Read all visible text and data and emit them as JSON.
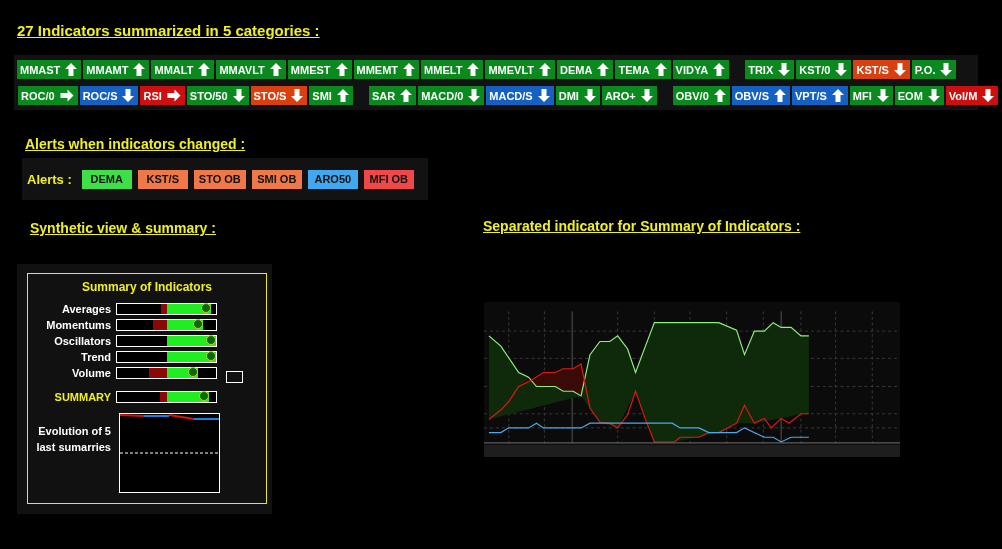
{
  "title": "27 Indicators summarized in 5 categories :",
  "indicator_rows": [
    {
      "groups": [
        [
          {
            "label": "MMAST",
            "kind": "up",
            "color": "#0a8a1e"
          },
          {
            "label": "MMAMT",
            "kind": "up",
            "color": "#0a8a1e"
          },
          {
            "label": "MMALT",
            "kind": "up",
            "color": "#0a8a1e"
          },
          {
            "label": "MMAVLT",
            "kind": "up",
            "color": "#0a8a1e"
          },
          {
            "label": "MMEST",
            "kind": "up",
            "color": "#0a8a1e"
          },
          {
            "label": "MMEMT",
            "kind": "up",
            "color": "#0a8a1e"
          },
          {
            "label": "MMELT",
            "kind": "up",
            "color": "#0a8a1e"
          },
          {
            "label": "MMEVLT",
            "kind": "up",
            "color": "#0a8a1e"
          },
          {
            "label": "DEMA",
            "kind": "up",
            "color": "#0a8a1e"
          },
          {
            "label": "TEMA",
            "kind": "up",
            "color": "#0a8a1e"
          },
          {
            "label": "VIDYA",
            "kind": "up",
            "color": "#0a8a1e"
          }
        ],
        [
          {
            "label": "TRIX",
            "kind": "down",
            "color": "#0a8a1e"
          },
          {
            "label": "KST/0",
            "kind": "down",
            "color": "#0a8a1e"
          },
          {
            "label": "KST/S",
            "kind": "down",
            "color": "#d84010"
          },
          {
            "label": "P.O.",
            "kind": "down",
            "color": "#0a8a1e"
          }
        ]
      ]
    },
    {
      "groups": [
        [
          {
            "label": "ROC/0",
            "kind": "right",
            "color": "#0a8a1e"
          },
          {
            "label": "ROC/S",
            "kind": "down",
            "color": "#1560c0"
          },
          {
            "label": "RSI",
            "kind": "right",
            "color": "#cc1010"
          },
          {
            "label": "STO/50",
            "kind": "down",
            "color": "#0a8a1e"
          },
          {
            "label": "STO/S",
            "kind": "down",
            "color": "#d84010"
          },
          {
            "label": "SMI",
            "kind": "up",
            "color": "#0a8a1e"
          }
        ],
        [
          {
            "label": "SAR",
            "kind": "up",
            "color": "#0a8a1e"
          },
          {
            "label": "MACD/0",
            "kind": "down",
            "color": "#0a8a1e"
          },
          {
            "label": "MACD/S",
            "kind": "down",
            "color": "#1560c0"
          },
          {
            "label": "DMI",
            "kind": "down",
            "color": "#0a8a1e"
          },
          {
            "label": "ARO+",
            "kind": "down",
            "color": "#0a8a1e"
          }
        ],
        [
          {
            "label": "OBV/0",
            "kind": "up",
            "color": "#0a8a1e"
          },
          {
            "label": "OBV/S",
            "kind": "up",
            "color": "#1560c0"
          },
          {
            "label": "VPT/S",
            "kind": "up",
            "color": "#1560c0"
          },
          {
            "label": "MFI",
            "kind": "down",
            "color": "#0a8a1e"
          },
          {
            "label": "EOM",
            "kind": "down",
            "color": "#0a8a1e"
          },
          {
            "label": "Vol/M",
            "kind": "down",
            "color": "#cc1010"
          }
        ]
      ]
    }
  ],
  "alerts_heading": "Alerts when indicators changed :",
  "alerts": {
    "label": "Alerts :",
    "items": [
      {
        "label": "DEMA",
        "color": "#3ee04a"
      },
      {
        "label": "KST/S",
        "color": "#f07848"
      },
      {
        "label": "STO OB",
        "color": "#f07848"
      },
      {
        "label": "SMI OB",
        "color": "#f07848"
      },
      {
        "label": "ARO50",
        "color": "#40a8f0"
      },
      {
        "label": "MFI OB",
        "color": "#f04848"
      }
    ]
  },
  "synthetic_heading": "Synthetic view & summary :",
  "separated_heading": "Separated indicator for Summary of Indicators :",
  "summary": {
    "title": "Summary of Indicators",
    "rows": [
      {
        "label": "Averages",
        "kind": "category",
        "negative": {
          "level": 0.12
        },
        "positive": {
          "level": 0.9
        }
      },
      {
        "label": "Momentums",
        "kind": "category",
        "negative": {
          "level": 0.28
        },
        "positive": {
          "level": 0.74
        }
      },
      {
        "label": "Oscillators",
        "kind": "category",
        "positive": {
          "level": 1
        }
      },
      {
        "label": "Trend",
        "kind": "category",
        "positive": {
          "level": 1
        }
      },
      {
        "label": "Volume",
        "kind": "category",
        "negative": {
          "level": 0.36
        },
        "positive": {
          "level": 0.64
        }
      },
      {
        "label": "SUMMARY",
        "kind": "total",
        "negative": {
          "level": 0.14
        },
        "positive": {
          "level": 0.86
        }
      }
    ],
    "evolution_label": "Evolution of 5 last sumarries"
  }
}
